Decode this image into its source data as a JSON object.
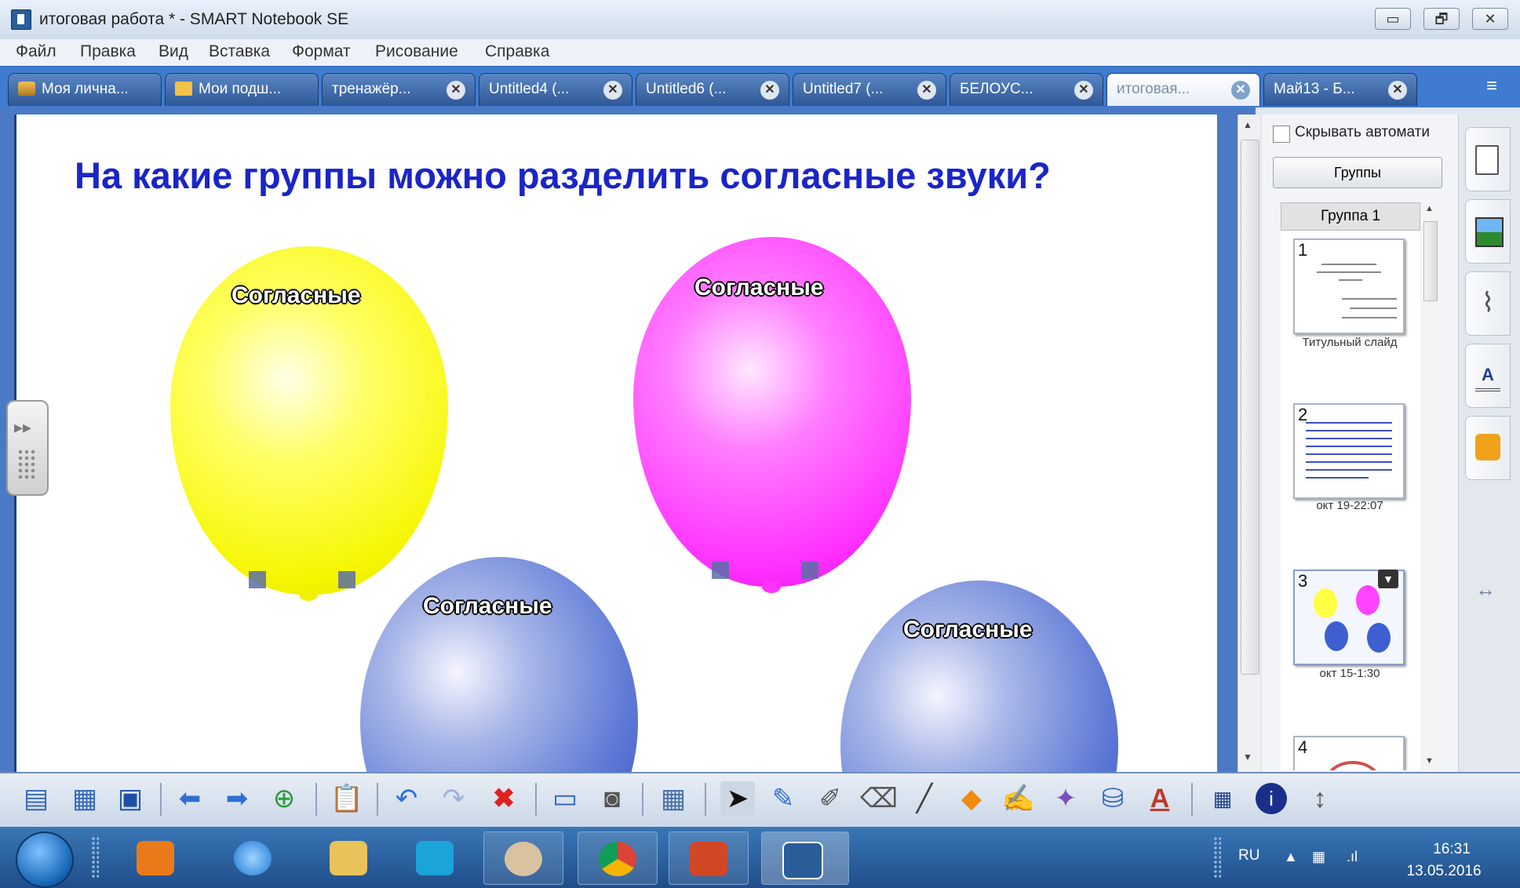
{
  "window": {
    "title": "итоговая работа * - SMART Notebook SE",
    "minimize_glyph": "▭",
    "restore_glyph": "🗗",
    "close_glyph": "✕"
  },
  "menu": [
    "Файл",
    "Правка",
    "Вид",
    "Вставка",
    "Формат",
    "Рисование",
    "Справка"
  ],
  "tabs": [
    {
      "label": "Моя лична...",
      "icon": "home-icon",
      "closable": false
    },
    {
      "label": "Мои подш...",
      "icon": "folder-icon",
      "closable": false
    },
    {
      "label": "тренажёр...",
      "closable": true
    },
    {
      "label": "Untitled4 (...",
      "closable": true
    },
    {
      "label": "Untitled6 (...",
      "closable": true
    },
    {
      "label": "Untitled7 (...",
      "closable": true
    },
    {
      "label": "БЕЛОУС...",
      "closable": true
    },
    {
      "label": "итоговая...",
      "closable": true,
      "active": true
    },
    {
      "label": "Май13 - Б...",
      "closable": true
    }
  ],
  "slide": {
    "title": "На какие группы можно разделить согласные звуки?",
    "balloons": [
      {
        "label": "Согласные",
        "color": "yellow"
      },
      {
        "label": "Согласные",
        "color": "magenta"
      },
      {
        "label": "Согласные",
        "color": "blue"
      },
      {
        "label": "Согласные",
        "color": "blue"
      }
    ]
  },
  "sorter": {
    "autohide_label": "Скрывать автомати",
    "groups_button": "Группы",
    "group_header": "Группа 1",
    "pages": [
      {
        "num": "1",
        "caption": "Титульный слайд"
      },
      {
        "num": "2",
        "caption": "окт 19-22:07"
      },
      {
        "num": "3",
        "caption": "окт 15-1:30"
      },
      {
        "num": "4",
        "caption": ""
      }
    ]
  },
  "side_tabs": [
    "page-sorter-icon",
    "gallery-icon",
    "attachments-icon",
    "properties-icon",
    "addons-icon"
  ],
  "toolbar_icons": [
    "new-page-icon",
    "new-file-icon",
    "save-icon",
    "back-icon",
    "forward-icon",
    "add-page-icon",
    "paste-icon",
    "undo-icon",
    "redo-icon",
    "delete-icon",
    "screen-shade-icon",
    "capture-icon",
    "table-icon",
    "select-icon",
    "pen-icon",
    "creative-pen-icon",
    "eraser-icon",
    "line-icon",
    "shapes-icon",
    "magic-pen-icon",
    "magic-wand-icon",
    "fill-icon",
    "text-icon",
    "properties-icon",
    "smart-icon",
    "move-toolbar-icon"
  ],
  "taskbar": {
    "lang": "RU",
    "time": "16:31",
    "date": "13.05.2016"
  },
  "colors": {
    "title_blue": "#1a25c8",
    "tab_bar": "#3e7bd1",
    "yellow": "#ffff33",
    "magenta": "#ff33ff",
    "balloon_blue": "#4a63c8"
  }
}
